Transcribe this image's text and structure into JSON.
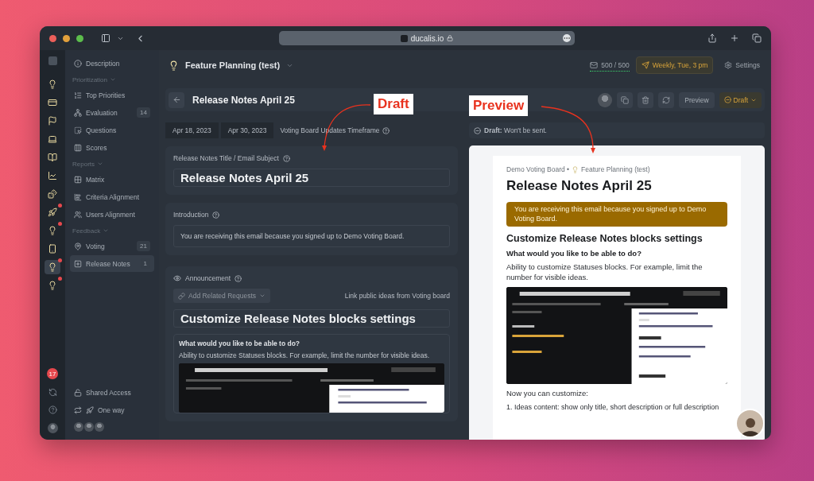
{
  "browser": {
    "url": "ducalis.io"
  },
  "rail": {
    "items": [
      {
        "dot": false,
        "selected": false
      },
      {
        "dot": false,
        "selected": false
      },
      {
        "dot": false,
        "selected": false
      },
      {
        "dot": false,
        "selected": false
      },
      {
        "dot": false,
        "selected": false
      },
      {
        "dot": false,
        "selected": false
      },
      {
        "dot": false,
        "selected": false
      },
      {
        "dot": true,
        "selected": false
      },
      {
        "dot": true,
        "selected": false
      },
      {
        "dot": false,
        "selected": false
      },
      {
        "dot": true,
        "selected": true
      },
      {
        "dot": true,
        "selected": false
      }
    ],
    "badge": "17"
  },
  "sidebar": {
    "items": [
      {
        "kind": "item",
        "label": "Description",
        "selected": false
      },
      {
        "kind": "section",
        "label": "Prioritization"
      },
      {
        "kind": "item",
        "label": "Top Priorities",
        "selected": false
      },
      {
        "kind": "item",
        "label": "Evaluation",
        "count": "14",
        "selected": false
      },
      {
        "kind": "item",
        "label": "Questions",
        "selected": false
      },
      {
        "kind": "item",
        "label": "Scores",
        "selected": false
      },
      {
        "kind": "section",
        "label": "Reports"
      },
      {
        "kind": "item",
        "label": "Matrix",
        "selected": false
      },
      {
        "kind": "item",
        "label": "Criteria Alignment",
        "selected": false
      },
      {
        "kind": "item",
        "label": "Users Alignment",
        "selected": false
      },
      {
        "kind": "section",
        "label": "Feedback"
      },
      {
        "kind": "item",
        "label": "Voting",
        "count": "21",
        "selected": false
      },
      {
        "kind": "item",
        "label": "Release Notes",
        "count": "1",
        "selected": true
      }
    ],
    "shared_access": "Shared Access",
    "sync_mode": "One way"
  },
  "header": {
    "project": "Feature Planning (test)",
    "email_quota": "500 / 500",
    "schedule": "Weekly, Tue, 3 pm",
    "settings": "Settings"
  },
  "toolbar": {
    "title": "Release Notes April 25",
    "preview_button": "Preview",
    "status": "Draft"
  },
  "timeframe": {
    "start": "Apr 18, 2023",
    "end": "Apr 30, 2023",
    "label": "Voting Board Updates Timeframe"
  },
  "status_note": "**Draft:** Won't be sent.",
  "editor": {
    "title_label": "Release Notes Title / Email Subject",
    "title_value": "Release Notes April 25",
    "intro_label": "Introduction",
    "intro_value": "You are receiving this email because you signed up to Demo Voting Board.",
    "announcement_label": "Announcement",
    "related_dropdown": "Add Related Requests",
    "related_hint": "Link public ideas from Voting board",
    "block_title": "Customize Release Notes blocks settings",
    "question": "What would you like to be able to do?",
    "answer": "Ability to customize Statuses blocks. For example, limit the number for visible ideas."
  },
  "preview": {
    "board": "Demo Voting Board •",
    "project": "Feature Planning (test)",
    "title": "Release Notes April 25",
    "notice": "You are receiving this email because you signed up to Demo Voting Board.",
    "block_title": "Customize Release Notes blocks settings",
    "question": "What would you like to be able to do?",
    "answer": "Ability to customize Statuses blocks. For example, limit the number for visible ideas.",
    "list_intro": "Now you can customize:",
    "list_item": "1. Ideas content: show only title, short description or full description"
  },
  "annotations": [
    {
      "label": "Draft"
    },
    {
      "label": "Preview"
    }
  ]
}
